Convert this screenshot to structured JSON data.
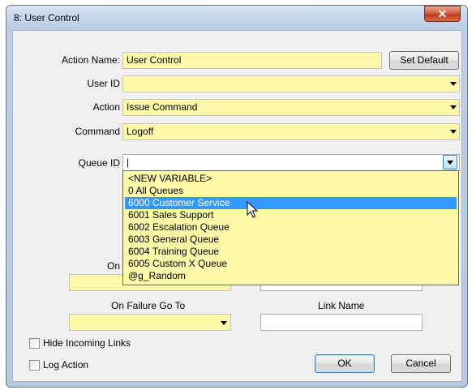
{
  "window": {
    "title": "8: User Control",
    "close_glyph": "✕"
  },
  "form": {
    "action_name": {
      "label": "Action Name:",
      "value": "User Control"
    },
    "set_default_label": "Set Default",
    "user_id": {
      "label": "User ID",
      "value": ""
    },
    "action": {
      "label": "Action",
      "value": "Issue Command"
    },
    "command": {
      "label": "Command",
      "value": "Logoff"
    },
    "queue_id": {
      "label": "Queue ID",
      "value": "|"
    },
    "on_partial_label": "On",
    "on_failure_label": "On Failure Go To",
    "link_name_label": "Link Name",
    "hide_incoming_links": {
      "label": "Hide Incoming Links",
      "checked": false
    },
    "log_action": {
      "label": "Log Action",
      "checked": false
    },
    "ok_label": "OK",
    "cancel_label": "Cancel"
  },
  "queue_dropdown": {
    "selected_index": 2,
    "options": [
      "<NEW VARIABLE>",
      "0 All Queues",
      "6000 Customer Service",
      "6001 Sales Support",
      "6002 Escalation Queue",
      "6003 General Queue",
      "6004 Training Queue",
      "6005 Custom X Queue",
      "@g_Random"
    ]
  },
  "colors": {
    "field_yellow": "#fdf9a8",
    "selection_blue": "#3399ff",
    "close_red": "#c0391f"
  }
}
